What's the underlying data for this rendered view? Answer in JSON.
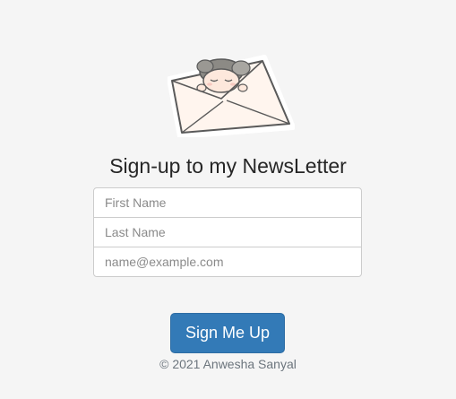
{
  "logo": {
    "icon": "envelope-with-girl-icon",
    "colors": {
      "outline": "#5a5a5a",
      "paper": "#fff5ee",
      "hair": "#8c8a85",
      "skin": "#fde8dc"
    }
  },
  "signup": {
    "heading": "Sign-up to my NewsLetter",
    "first_name_placeholder": "First Name",
    "last_name_placeholder": "Last Name",
    "email_placeholder": "name@example.com",
    "submit_label": "Sign Me Up"
  },
  "footer": {
    "copyright": "© 2021 Anwesha Sanyal"
  },
  "theme": {
    "background": "#f5f5f5",
    "primary": "#337ab7",
    "input_border": "#cccccc"
  }
}
